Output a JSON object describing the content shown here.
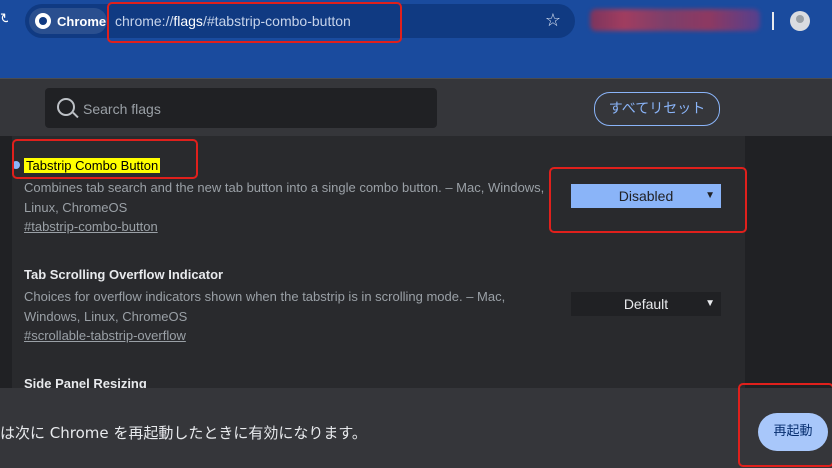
{
  "browser": {
    "chip_label": "Chrome",
    "url_prefix": "chrome://",
    "url_bold": "flags",
    "url_suffix": "/#tabstrip-combo-button",
    "star_icon": "star-icon",
    "annotation_color": "#e0201c"
  },
  "header": {
    "search_placeholder": "Search flags",
    "reset_label": "すべてリセット"
  },
  "experiments": [
    {
      "title": "Tabstrip Combo Button",
      "description": "Combines tab search and the new tab button into a single combo button. – Mac, Windows, Linux, ChromeOS",
      "link": "#tabstrip-combo-button",
      "value": "Disabled"
    },
    {
      "title": "Tab Scrolling Overflow Indicator",
      "description": "Choices for overflow indicators shown when the tabstrip is in scrolling mode. – Mac, Windows, Linux, ChromeOS",
      "link": "#scrollable-tabstrip-overflow",
      "value": "Default"
    },
    {
      "title": "Side Panel Resizing"
    }
  ],
  "footer": {
    "restart_message": "は次に Chrome を再起動したときに有効になります。",
    "restart_label": "再起動"
  }
}
